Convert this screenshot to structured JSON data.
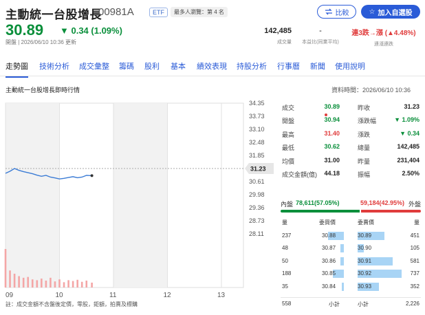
{
  "header": {
    "title": "主動統一台股增長",
    "code": "00981A",
    "etf_badge": "ETF",
    "rank_badge": "最多人瀏覽：第 4 名",
    "compare_label": "比較",
    "add_watch_label": "加入自選股",
    "price": "30.89",
    "change": "▼ 0.34 (1.09%)",
    "status": "開盤 | 2026/06/10 10:36 更新",
    "volume_value": "142,485",
    "volume_label": "成交量",
    "pbr_value": "-",
    "pbr_label": "本益比(同業平均)",
    "streak_value": "連3跌→漲 (▲4.48%)",
    "streak_label": "連漲連跌"
  },
  "tabs": [
    "走勢圖",
    "技術分析",
    "成交彙整",
    "籌碼",
    "股利",
    "基本",
    "績效表現",
    "持股分析",
    "行事曆",
    "新聞",
    "使用說明"
  ],
  "section": {
    "title": "主動統一台股增長即時行情",
    "time": "資料時間：2026/06/10 10:36"
  },
  "chart_data": {
    "type": "line",
    "y_ticks": [
      "34.35",
      "33.73",
      "33.10",
      "32.48",
      "31.85",
      "31.23",
      "30.61",
      "29.98",
      "29.36",
      "28.73",
      "28.11"
    ],
    "ylim": [
      28.11,
      34.35
    ],
    "x_ticks": [
      "09",
      "10",
      "11",
      "12",
      "13"
    ],
    "reference": 31.23,
    "reference_label": "31.23",
    "x": [
      "09:00",
      "09:05",
      "09:10",
      "09:15",
      "09:20",
      "09:25",
      "09:30",
      "09:35",
      "09:40",
      "09:45",
      "09:50",
      "09:55",
      "10:00",
      "10:05",
      "10:10",
      "10:15",
      "10:20",
      "10:25",
      "10:30",
      "10:36"
    ],
    "values": [
      31.0,
      31.1,
      31.23,
      31.14,
      31.08,
      31.03,
      30.98,
      30.91,
      30.86,
      30.9,
      30.82,
      30.78,
      30.73,
      30.76,
      30.8,
      30.84,
      30.79,
      30.82,
      30.9,
      30.89
    ],
    "volumes": [
      95,
      42,
      34,
      28,
      24,
      26,
      20,
      18,
      22,
      17,
      24,
      15,
      20,
      13,
      18,
      16,
      19,
      14,
      17,
      12
    ]
  },
  "quote_table": [
    {
      "l1": "成交",
      "v1": "30.89",
      "c1": "grn",
      "l2": "昨收",
      "v2": "31.23",
      "c2": "blk"
    },
    {
      "l1": "開盤",
      "v1": "30.94",
      "c1": "grn",
      "l2": "漲跌幅",
      "v2": "▼ 1.09%",
      "c2": "grn"
    },
    {
      "l1": "最高",
      "v1": "31.40",
      "c1": "red",
      "l2": "漲跌",
      "v2": "▼ 0.34",
      "c2": "grn"
    },
    {
      "l1": "最低",
      "v1": "30.62",
      "c1": "grn",
      "l2": "總量",
      "v2": "142,485",
      "c2": "blk"
    },
    {
      "l1": "均價",
      "v1": "31.00",
      "c1": "blk",
      "l2": "昨量",
      "v2": "231,404",
      "c2": "blk"
    },
    {
      "l1": "成交金額(億)",
      "v1": "44.18",
      "c1": "blk",
      "l2": "振幅",
      "v2": "2.50%",
      "c2": "blk"
    }
  ],
  "inout": {
    "in_label": "內盤",
    "in_value": "78,611(57.05%)",
    "in_ratio": 0.5705,
    "out_value": "59,184(42.95%)",
    "out_label": "外盤"
  },
  "orderbook": {
    "headers": [
      "量",
      "委買價",
      "委賣價",
      "量"
    ],
    "rows": [
      {
        "bid_qty": "237",
        "bid_price": "30.88",
        "ask_price": "30.89",
        "ask_qty": "451",
        "bid_fill": 0.47,
        "ask_fill": 0.61
      },
      {
        "bid_qty": "48",
        "bid_price": "30.87",
        "ask_price": "30.90",
        "ask_qty": "105",
        "bid_fill": 0.1,
        "ask_fill": 0.14
      },
      {
        "bid_qty": "50",
        "bid_price": "30.86",
        "ask_price": "30.91",
        "ask_qty": "581",
        "bid_fill": 0.1,
        "ask_fill": 0.79
      },
      {
        "bid_qty": "188",
        "bid_price": "30.85",
        "ask_price": "30.92",
        "ask_qty": "737",
        "bid_fill": 0.34,
        "ask_fill": 1.0
      },
      {
        "bid_qty": "35",
        "bid_price": "30.84",
        "ask_price": "30.93",
        "ask_qty": "352",
        "bid_fill": 0.07,
        "ask_fill": 0.48
      }
    ],
    "total_bid": "558",
    "subtotal_label": "小計",
    "total_ask": "2,226"
  },
  "note": "註：成交金額不含盤後定價，零股，鉅額，拍賣及標購",
  "colors": {
    "up": "#e03c3c",
    "down": "#0a8f3b",
    "accent": "#2a5bd7",
    "line": "#3a7bd5"
  }
}
